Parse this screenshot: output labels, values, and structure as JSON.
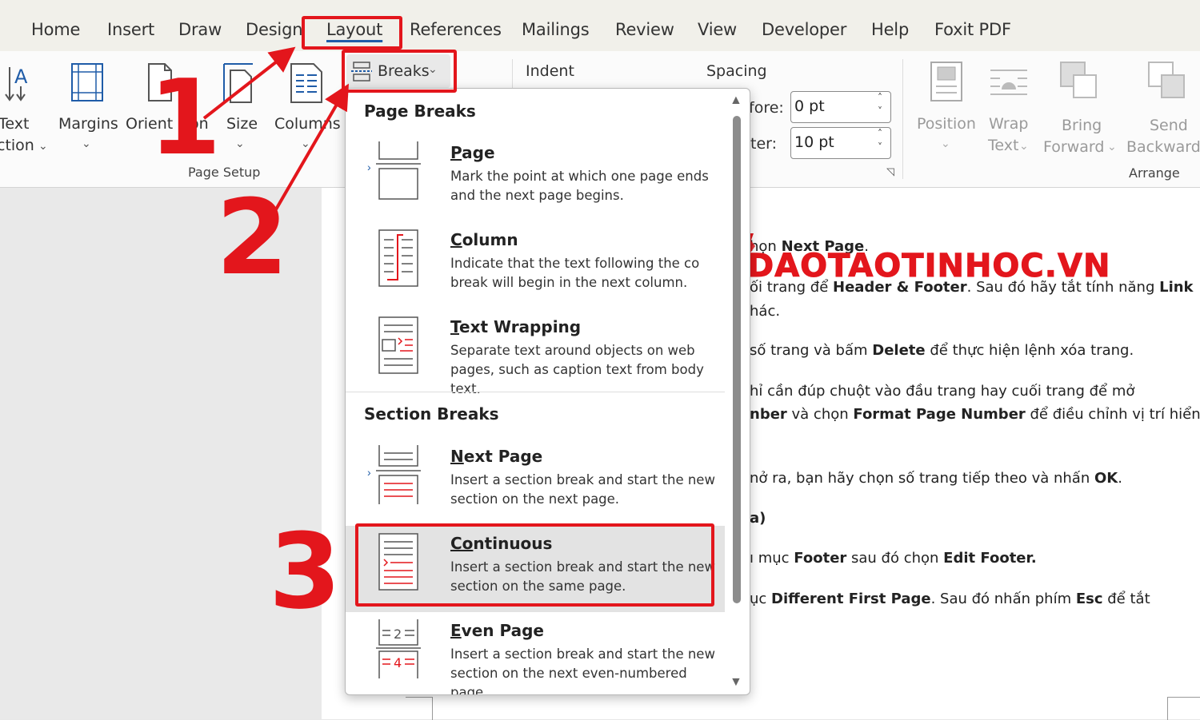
{
  "tabs": [
    "Home",
    "Insert",
    "Draw",
    "Design",
    "Layout",
    "References",
    "Mailings",
    "Review",
    "View",
    "Developer",
    "Help",
    "Foxit PDF"
  ],
  "ribbon": {
    "text_direction": [
      "Text",
      "ction"
    ],
    "margins": "Margins",
    "orientation": "Orient",
    "orientation_tail": "on",
    "size": "Size",
    "columns": "Columns",
    "breaks": "Breaks",
    "indent": "Indent",
    "spacing": "Spacing",
    "before_label": "fore:",
    "before_value": "0 pt",
    "after_label": "ter:",
    "after_value": "10 pt",
    "page_setup": "Page Setup",
    "position": "Position",
    "wrap": [
      "Wrap",
      "Text"
    ],
    "bring": [
      "Bring",
      "Forward"
    ],
    "send": [
      "Send",
      "Backward"
    ],
    "arrange": "Arrange"
  },
  "dropdown": {
    "page_breaks_header": "Page Breaks",
    "section_breaks_header": "Section Breaks",
    "items": [
      {
        "title_u": "P",
        "title_rest": "age",
        "desc": "Mark the point at which one page ends and the next page begins."
      },
      {
        "title_u": "C",
        "title_rest": "olumn",
        "desc": "Indicate that the text following the co"
      },
      {
        "title_u": "T",
        "title_rest": "ext Wrapping",
        "desc": "Separate text around objects on web pages, such as caption text from body text."
      },
      {
        "title_u": "N",
        "title_rest": "ext Page",
        "desc": "Insert a section break and start the new section on the next page."
      },
      {
        "title_u": "Co",
        "title_rest": "ntinuous",
        "desc": "Insert a section break and start the new section on the same page."
      },
      {
        "title_u": "E",
        "title_rest": "ven Page",
        "desc": "Insert a section break and start the new section on the next even-numbered page."
      }
    ],
    "column_desc_line2": "break will begin in the next column."
  },
  "document": {
    "lines": [
      {
        "pre": "họn ",
        "b": "Next Page",
        "post": "."
      },
      {
        "pre": "ối trang để ",
        "b": "Header & Footer",
        "post": ". Sau đó hãy tắt tính năng ",
        "b2": "Link"
      },
      {
        "pre": "hác.",
        "b": "",
        "post": ""
      },
      {
        "pre": "số trang và bấm ",
        "b": "Delete",
        "post": " để thực hiện lệnh xóa trang."
      },
      {
        "pre": "hỉ cần đúp chuột vào đầu trang hay cuối trang để mở",
        "b": "",
        "post": ""
      },
      {
        "pre": "",
        "b": "nber",
        "post": " và chọn ",
        "b2": "Format Page Number",
        "post2": " để điều chỉnh vị trí hiển"
      },
      {
        "pre": "nở ra, bạn hãy chọn số trang tiếp theo và nhấn ",
        "b": "OK",
        "post": "."
      },
      {
        "pre": "",
        "b": "a)",
        "post": ""
      },
      {
        "pre": "ı mục ",
        "b": "Footer",
        "post": " sau đó chọn ",
        "b2": "Edit Footer."
      },
      {
        "pre": "ục ",
        "b": "Different First Page",
        "post": ". Sau đó nhấn phím ",
        "b2": "Esc",
        "post2": " để tắt"
      }
    ]
  },
  "watermark": "DAOTAOTINHOC.VN",
  "annotations": [
    "1",
    "2",
    "3"
  ],
  "colors": {
    "annotation_red": "#e3161c",
    "tab_bar": "#f1f0ea",
    "ribbon": "#fbfbfb",
    "highlight": "#e3e3e3"
  }
}
